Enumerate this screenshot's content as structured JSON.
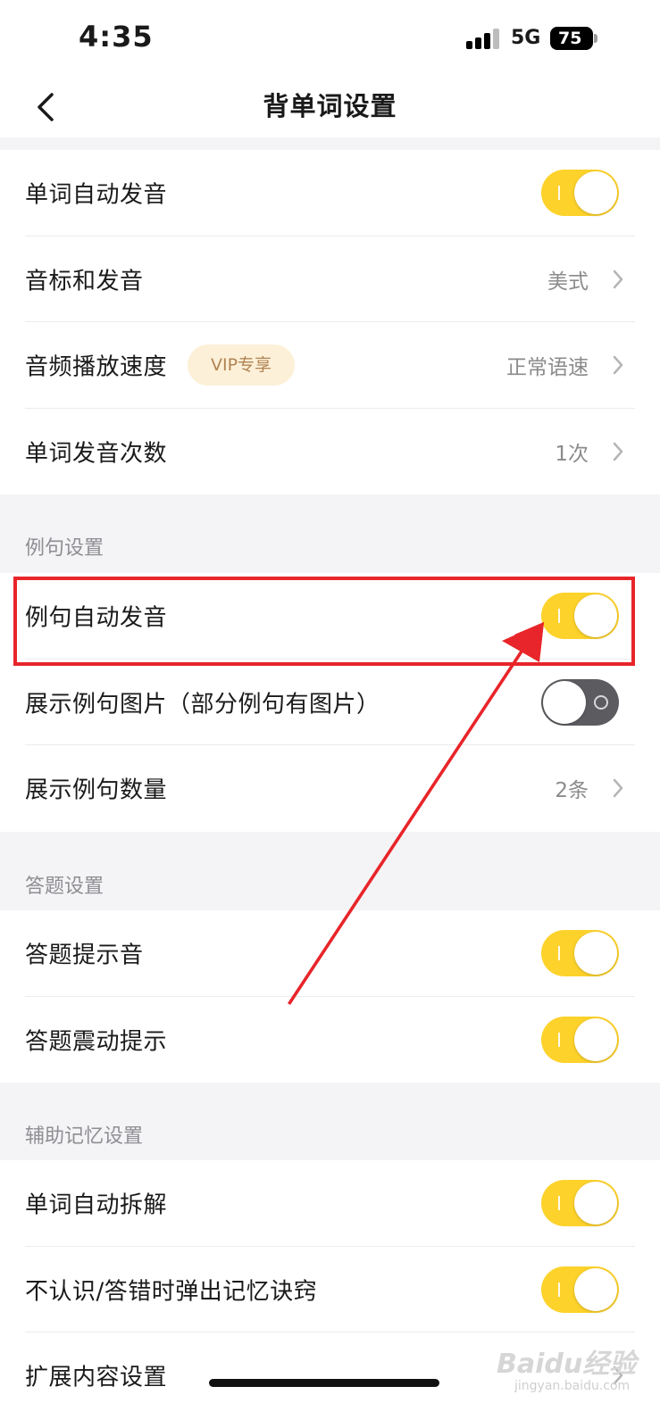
{
  "status_bar": {
    "time": "4:35",
    "network": "5G",
    "battery": "75"
  },
  "nav": {
    "title": "背单词设置"
  },
  "word_group": {
    "auto_pronounce": {
      "label": "单词自动发音",
      "on": true
    },
    "phonetic": {
      "label": "音标和发音",
      "value": "美式"
    },
    "audio_speed": {
      "label": "音频播放速度",
      "badge": "VIP专享",
      "value": "正常语速"
    },
    "pronounce_count": {
      "label": "单词发音次数",
      "value": "1次"
    }
  },
  "example_section": {
    "header": "例句设置",
    "auto_pronounce": {
      "label": "例句自动发音",
      "on": true
    },
    "show_images": {
      "label": "展示例句图片（部分例句有图片）",
      "on": false
    },
    "count": {
      "label": "展示例句数量",
      "value": "2条"
    }
  },
  "answer_section": {
    "header": "答题设置",
    "sound": {
      "label": "答题提示音",
      "on": true
    },
    "vibrate": {
      "label": "答题震动提示",
      "on": true
    }
  },
  "memory_section": {
    "header": "辅助记忆设置",
    "auto_split": {
      "label": "单词自动拆解",
      "on": true
    },
    "mnemonic_popup": {
      "label": "不认识/答错时弹出记忆诀窍",
      "on": true
    },
    "extended": {
      "label": "扩展内容设置"
    }
  },
  "watermark": {
    "main": "Baidu经验",
    "sub": "jingyan.baidu.com"
  },
  "colors": {
    "toggle_on": "#fdd22b",
    "toggle_off": "#5c5c60",
    "highlight": "#e8252a"
  }
}
